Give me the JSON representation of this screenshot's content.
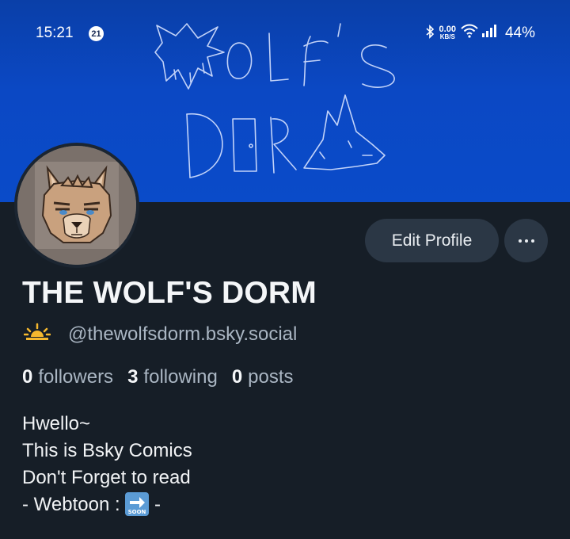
{
  "status_bar": {
    "time": "15:21",
    "notification_count": "21",
    "net_speed_value": "0.00",
    "net_speed_unit": "KB/S",
    "battery": "44%"
  },
  "banner": {
    "art_text_line1": "WOLF'S",
    "art_text_line2": "DORM"
  },
  "profile": {
    "edit_button_label": "Edit Profile",
    "display_name": "THE WOLF'S DORM",
    "handle": "@thewolfsdorm.bsky.social",
    "followers_count": "0",
    "followers_label": "followers",
    "following_count": "3",
    "following_label": "following",
    "posts_count": "0",
    "posts_label": "posts",
    "bio_lines": [
      "Hwello~",
      "This is Bsky Comics",
      "Don't Forget to read"
    ],
    "bio_last_prefix": "- Webtoon : ",
    "bio_last_suffix": " -",
    "soon_icon_text": "SOON"
  },
  "colors": {
    "banner": "#0b48c4",
    "background": "#161e27",
    "button": "#2b3745",
    "muted_text": "#aab6c3"
  }
}
